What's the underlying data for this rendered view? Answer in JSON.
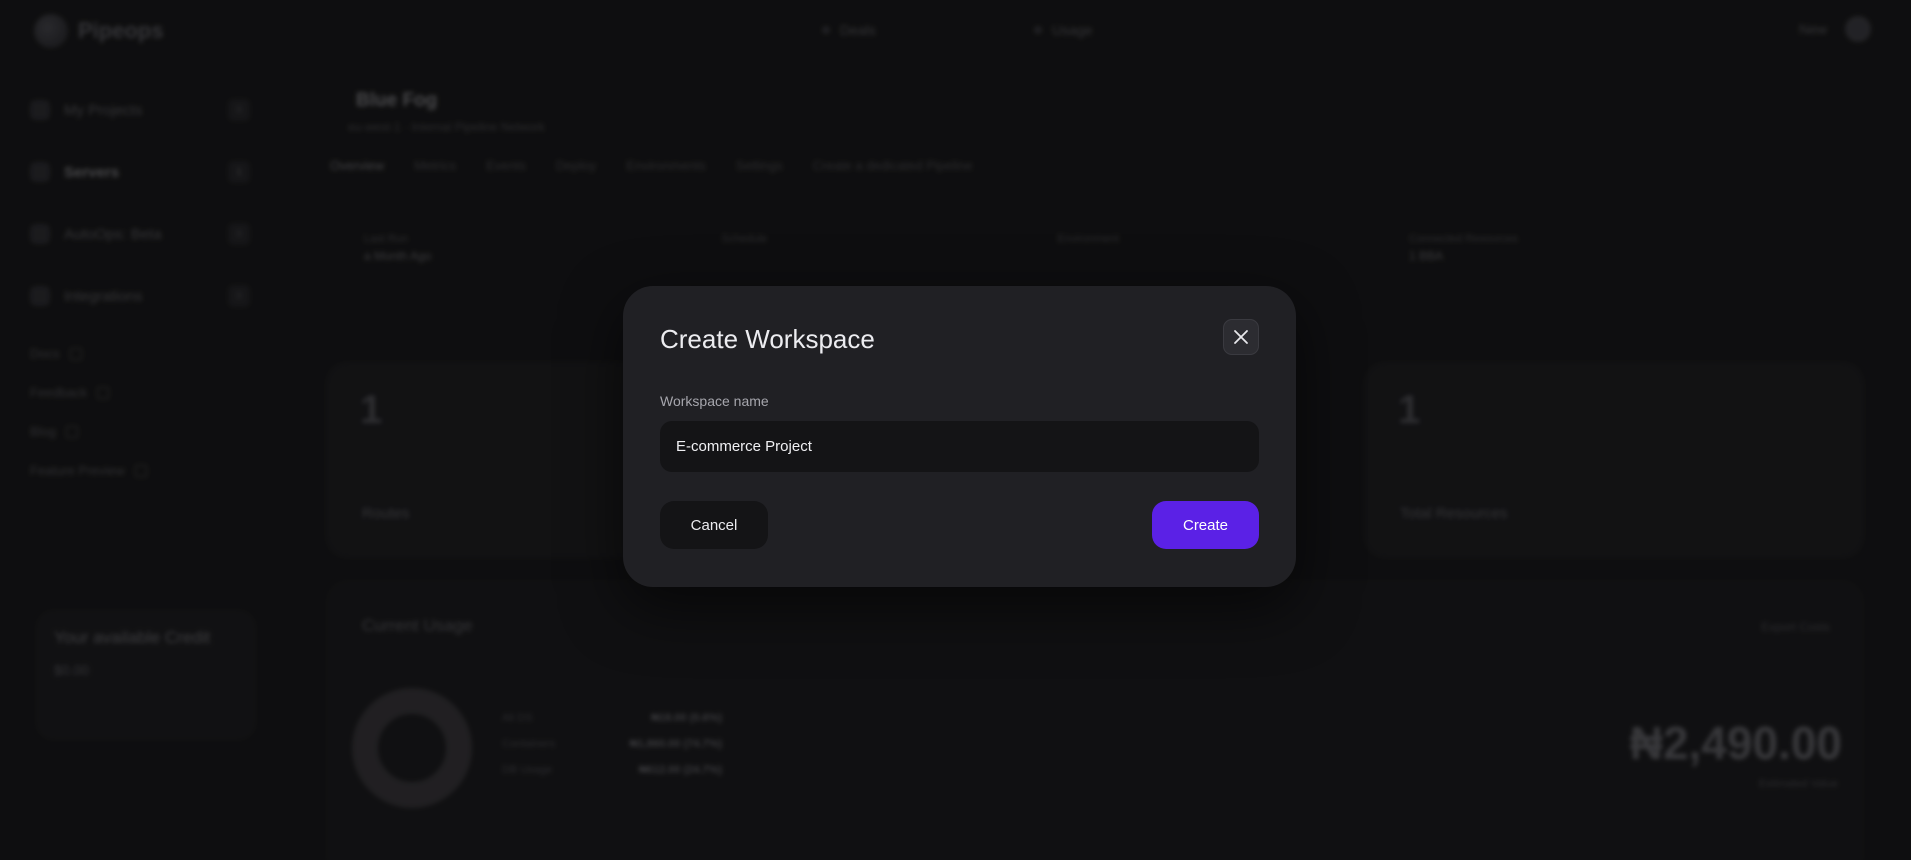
{
  "colors": {
    "primary": "#5b21e6",
    "modal_bg": "#202024",
    "input_bg": "#141416",
    "page_bg": "#121214"
  },
  "background": {
    "logo_text": "Pipeops",
    "top_nav": [
      "Deals",
      "Usage"
    ],
    "top_right_label": "New",
    "sidebar": {
      "items": [
        {
          "label": "My Projects",
          "icon": "folder-icon",
          "count": "0"
        },
        {
          "label": "Servers",
          "icon": "server-icon",
          "count": "1"
        },
        {
          "label": "AutoOps: Beta",
          "icon": "spark-icon",
          "count": "0"
        },
        {
          "label": "Integrations",
          "icon": "plug-icon",
          "count": "0"
        }
      ],
      "links": [
        "Docs",
        "Feedback",
        "Blog",
        "Feature Preview"
      ],
      "credit_title": "Your available Credit",
      "credit_value": "$0.00"
    },
    "project": {
      "title": "Blue Fog",
      "subtitle": "eu-west-1 · Internal Pipeline Network",
      "tabs": [
        "Overview",
        "Metrics",
        "Events",
        "Deploy",
        "Environments",
        "Settings"
      ],
      "hint": "Create a dedicated Pipeline",
      "routes_label": "Routes",
      "stats": [
        {
          "label": "Last Run",
          "value": "a Month Ago"
        },
        {
          "label": "Schedule",
          "value": ""
        },
        {
          "label": "Environment",
          "value": ""
        },
        {
          "label": "Connected Resources",
          "value": "1 BBA"
        }
      ]
    },
    "cards": [
      {
        "number": "1",
        "label": "Routes"
      },
      {
        "number": "1",
        "label": "Total Resources"
      }
    ],
    "usage": {
      "title": "Current Usage",
      "export_label": "Export Costs",
      "rows": [
        {
          "label": "Ali DS",
          "value": "₦18.00 (0.6%)"
        },
        {
          "label": "Containers",
          "value": "₦1,860.00 (74.7%)"
        },
        {
          "label": "DB Usage",
          "value": "₦612.00 (24.7%)"
        }
      ],
      "total": "₦2,490.00",
      "total_label": "Estimated Value"
    }
  },
  "modal": {
    "title": "Create Workspace",
    "field_label": "Workspace name",
    "field_value": "E-commerce Project",
    "cancel_label": "Cancel",
    "create_label": "Create"
  }
}
